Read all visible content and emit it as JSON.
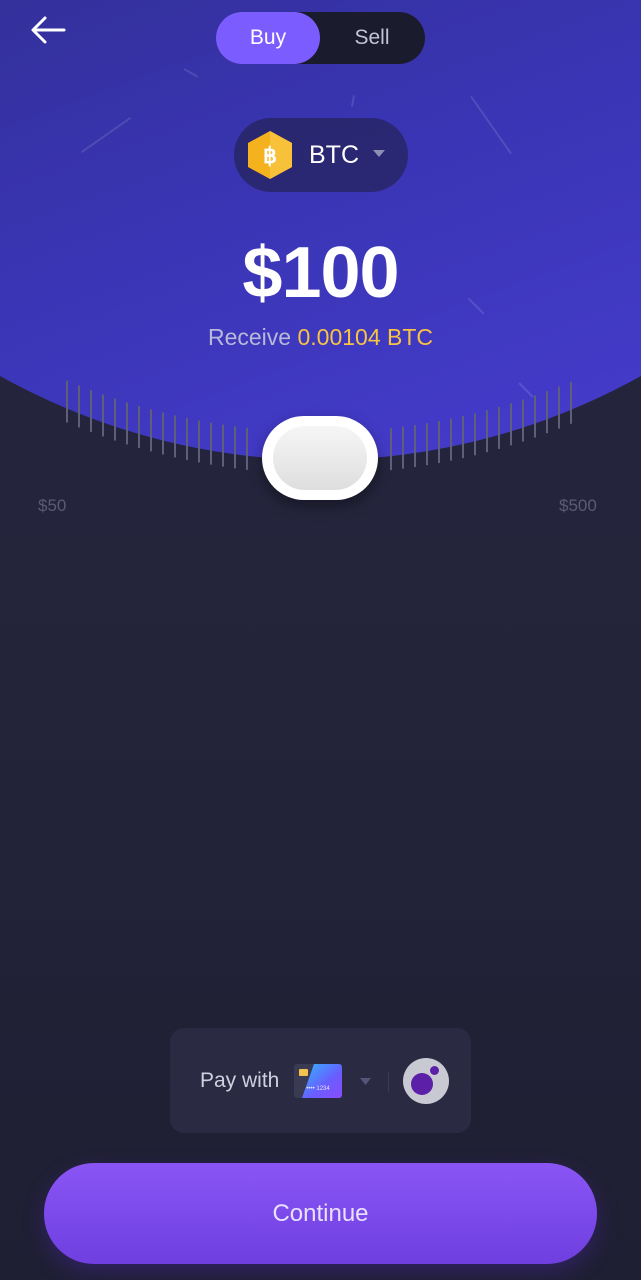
{
  "trade_toggle": {
    "buy_label": "Buy",
    "sell_label": "Sell",
    "selected": "Buy"
  },
  "asset": {
    "symbol": "BTC",
    "icon": "bitcoin-icon",
    "icon_color": "#f5b21f"
  },
  "amount": {
    "value": "$100",
    "receive_label": "Receive",
    "receive_value": "0.00104 BTC"
  },
  "slider": {
    "min_label": "$50",
    "max_label": "$500",
    "current": 100,
    "min": 50,
    "max": 500
  },
  "payment": {
    "label": "Pay with",
    "method_icon": "credit-card-icon",
    "card_digits": "•••• 1234",
    "wallet_icon": "wallet-app-icon"
  },
  "cta": {
    "label": "Continue"
  },
  "colors": {
    "accent": "#7b5cff",
    "highlight": "#f6c344",
    "background": "#22223a"
  }
}
